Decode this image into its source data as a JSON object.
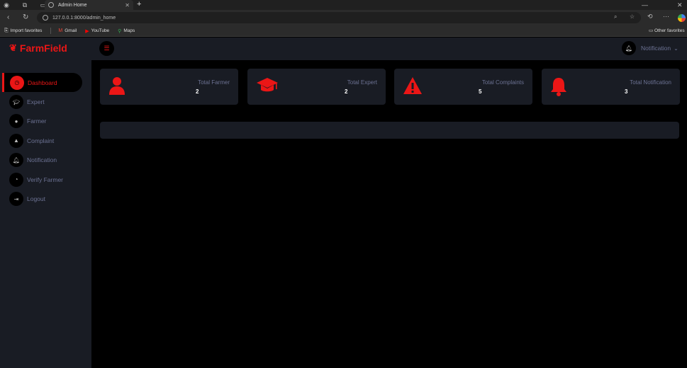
{
  "browser": {
    "tab_title": "Admin Home",
    "url": "127.0.0.1:8000/admin_home",
    "bookmarks": [
      {
        "label": "Import favorites",
        "icon": "import-icon"
      },
      {
        "label": "Gmail",
        "icon": "gmail-icon"
      },
      {
        "label": "YouTube",
        "icon": "youtube-icon"
      },
      {
        "label": "Maps",
        "icon": "maps-icon"
      }
    ],
    "other_favorites": "Other favorites"
  },
  "app": {
    "brand": "FarmField",
    "brand_color": "#eb1616",
    "notification_label": "Notification"
  },
  "sidebar": {
    "items": [
      {
        "label": "Dashboard",
        "icon": "dashboard-icon",
        "active": true
      },
      {
        "label": "Expert",
        "icon": "graduation-cap-icon"
      },
      {
        "label": "Farmer",
        "icon": "user-icon"
      },
      {
        "label": "Complaint",
        "icon": "warning-icon"
      },
      {
        "label": "Notification",
        "icon": "bell-icon"
      },
      {
        "label": "Verify Farmer",
        "icon": "verify-icon"
      },
      {
        "label": "Logout",
        "icon": "logout-icon"
      }
    ]
  },
  "cards": [
    {
      "title": "Total Farmer",
      "value": "2",
      "icon": "user-icon"
    },
    {
      "title": "Total Expert",
      "value": "2",
      "icon": "graduation-cap-icon"
    },
    {
      "title": "Total Complaints",
      "value": "5",
      "icon": "warning-icon"
    },
    {
      "title": "Total Notification",
      "value": "3",
      "icon": "bell-icon"
    }
  ]
}
